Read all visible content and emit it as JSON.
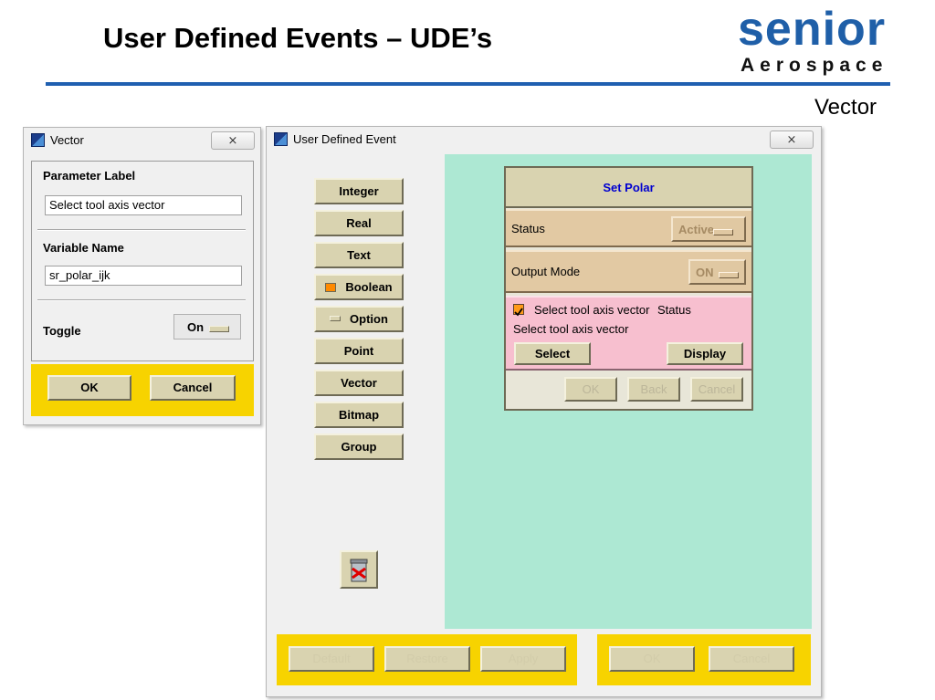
{
  "slide": {
    "title": "User Defined Events – UDE’s",
    "subtitle": "Vector",
    "logo": {
      "word": "senior",
      "tag": "Aerospace",
      "color": "#1f5fa8"
    }
  },
  "vector_dialog": {
    "title": "Vector",
    "close_label": "⨯",
    "parameter_label_heading": "Parameter Label",
    "parameter_label_value": "Select tool axis vector",
    "variable_name_heading": "Variable Name",
    "variable_name_value": "sr_polar_ijk",
    "toggle_heading": "Toggle",
    "toggle_value": "On",
    "ok_label": "OK",
    "cancel_label": "Cancel"
  },
  "ude_window": {
    "title": "User Defined Event",
    "close_label": "⨯",
    "palette": [
      "Integer",
      "Real",
      "Text",
      "Boolean",
      "Option",
      "Point",
      "Vector",
      "Bitmap",
      "Group"
    ],
    "trash_icon": "trash-can-icon",
    "bottom_left_buttons": [
      "Default",
      "Restore",
      "Apply"
    ],
    "bottom_right_buttons": [
      "OK",
      "Cancel"
    ]
  },
  "preview": {
    "title": "Set Polar",
    "status_label": "Status",
    "status_value": "Active",
    "output_mode_label": "Output Mode",
    "output_mode_value": "ON",
    "checkbox_label": "Select tool axis vector",
    "checkbox_status": "Status",
    "checkbox_checked": true,
    "vector_prompt": "Select tool axis vector",
    "select_label": "Select",
    "display_label": "Display",
    "ok_label": "OK",
    "back_label": "Back",
    "cancel_label": "Cancel"
  },
  "colors": {
    "accent_blue": "#1f5fb0",
    "canvas_green": "#ade8d3",
    "highlight_yellow": "#f7d300",
    "panel_tan": "#e2c9a3",
    "panel_pink": "#f7bfcf",
    "button_khaki": "#d9d3b0"
  }
}
